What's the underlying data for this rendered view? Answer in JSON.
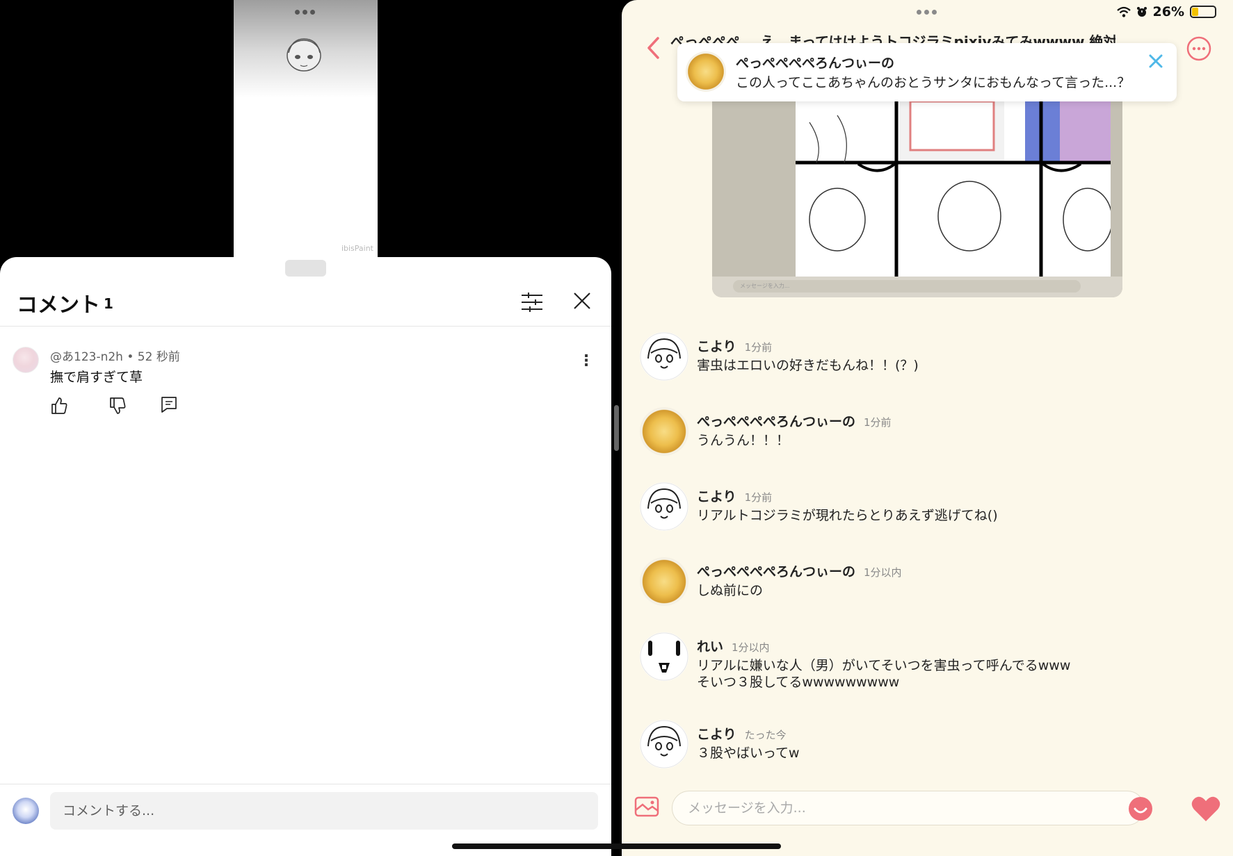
{
  "youtube": {
    "comments_title": "コメント",
    "comments_count": "1",
    "comment": {
      "author_time": "@あ123-n2h • 52 秒前",
      "text": "撫で肩すぎて草"
    },
    "input_placeholder": "コメントする..."
  },
  "chat": {
    "status": {
      "battery": "26%"
    },
    "header_title": "ぺっぺぺぺ... え、まってはけようトコジラミpixivみてみwwww 絶対親許もらっ...",
    "notification": {
      "sender": "ぺっぺぺぺぺろんつぃーの",
      "text": "この人ってここあちゃんのおとうサンタにおもんなって言った...？"
    },
    "shared_image": {
      "input_placeholder": "メッセージを入力..."
    },
    "messages": [
      {
        "name": "こより",
        "time": "1分前",
        "lines": [
          "害虫はエロいの好きだもんね！！(？)"
        ]
      },
      {
        "name": "ぺっぺぺぺぺろんつぃーの",
        "time": "1分前",
        "lines": [
          "うんうん！！！"
        ]
      },
      {
        "name": "こより",
        "time": "1分前",
        "lines": [
          "リアルトコジラミが現れたらとりあえず逃げてね()"
        ]
      },
      {
        "name": "ぺっぺぺぺぺろんつぃーの",
        "time": "1分以内",
        "lines": [
          "しぬ前にの"
        ]
      },
      {
        "name": "れい",
        "time": "1分以内",
        "lines": [
          "リアルに嫌いな人（男）がいてそいつを害虫って呼んでるwww",
          "そいつ３股してるwwwwwwwww"
        ]
      },
      {
        "name": "こより",
        "time": "たった今",
        "lines": [
          "３股やばいってw"
        ]
      }
    ],
    "input_placeholder": "メッセージを入力..."
  },
  "colors": {
    "chat_bg": "#fcf8ea",
    "accent_pink": "#ef6f7a",
    "notification_close": "#4fb8e8"
  }
}
